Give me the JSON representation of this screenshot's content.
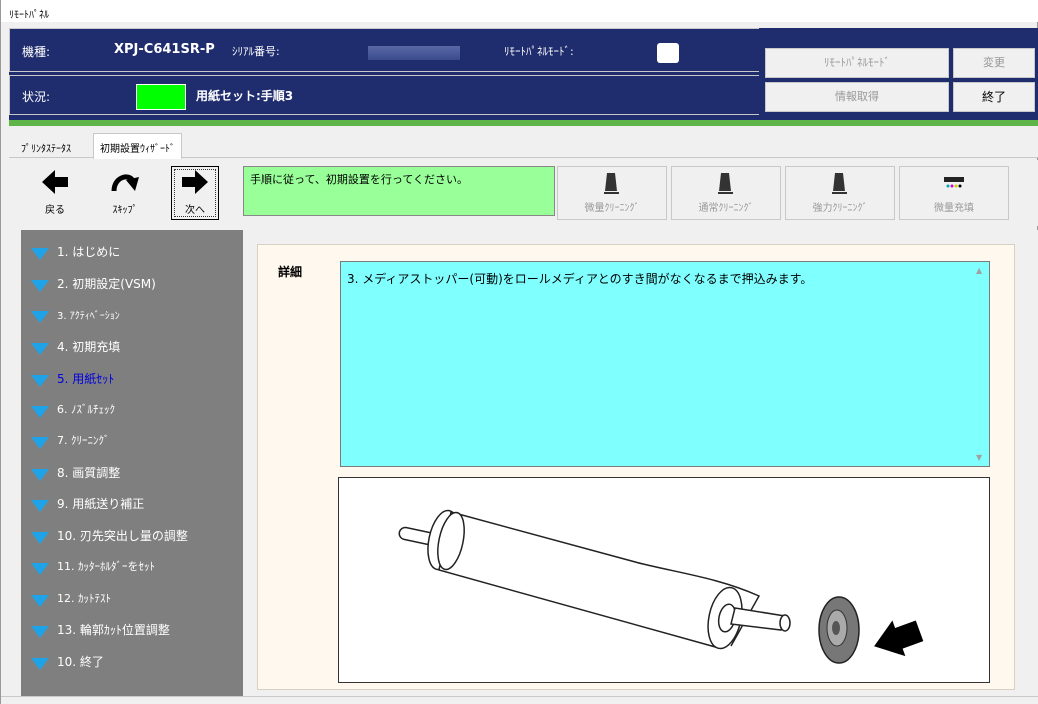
{
  "window": {
    "title": "ﾘﾓｰﾄﾊﾟﾈﾙ"
  },
  "header": {
    "model_label": "機種:",
    "model_value": "XPJ-C641SR-P",
    "serial_label": "ｼﾘｱﾙ番号:",
    "remote_mode_label": "ﾘﾓｰﾄﾊﾟﾈﾙﾓｰﾄﾞ:",
    "status_label": "状況:",
    "status_value": "用紙セット:手順3",
    "status_color": "#00ff00",
    "buttons": {
      "remote_mode": "ﾘﾓｰﾄﾊﾟﾈﾙﾓｰﾄﾞ",
      "change": "変更",
      "get_info": "情報取得",
      "exit": "終了"
    }
  },
  "tabs": [
    {
      "label": "ﾌﾟﾘﾝﾀｽﾃｰﾀｽ"
    },
    {
      "label": "初期設置ｳｨｻﾞｰﾄﾞ"
    }
  ],
  "toolbar": {
    "back": "戻る",
    "skip": "ｽｷｯﾌﾟ",
    "next": "次へ",
    "message": "手順に従って、初期設置を行ってください。",
    "message_bg": "#99ff99",
    "cleaning_buttons": [
      "微量ｸﾘｰﾆﾝｸﾞ",
      "通常ｸﾘｰﾆﾝｸﾞ",
      "強力ｸﾘｰﾆﾝｸﾞ",
      "微量充填"
    ]
  },
  "steps": [
    {
      "label": "1. はじめに"
    },
    {
      "label": "2. 初期設定(VSM)"
    },
    {
      "label": "3. ｱｸﾃｨﾍﾞｰｼｮﾝ"
    },
    {
      "label": "4. 初期充填"
    },
    {
      "label": "5. 用紙ｾｯﾄ"
    },
    {
      "label": "6. ﾉｽﾞﾙﾁｪｯｸ"
    },
    {
      "label": "7. ｸﾘｰﾆﾝｸﾞ"
    },
    {
      "label": "8. 画質調整"
    },
    {
      "label": "9. 用紙送り補正"
    },
    {
      "label": "10. 刃先突出し量の調整"
    },
    {
      "label": "11. ｶｯﾀｰﾎﾙﾀﾞｰをｾｯﾄ"
    },
    {
      "label": "12. ｶｯﾄﾃｽﾄ"
    },
    {
      "label": "13. 輪郭ｶｯﾄ位置調整"
    },
    {
      "label": "10. 終了"
    }
  ],
  "current_step": "5. 用紙ｾｯﾄ",
  "detail": {
    "label": "詳細",
    "text": "3. メディアストッパー(可動)をロールメディアとのすき間がなくなるまで押込みます。",
    "text_bg": "#80ffff"
  }
}
